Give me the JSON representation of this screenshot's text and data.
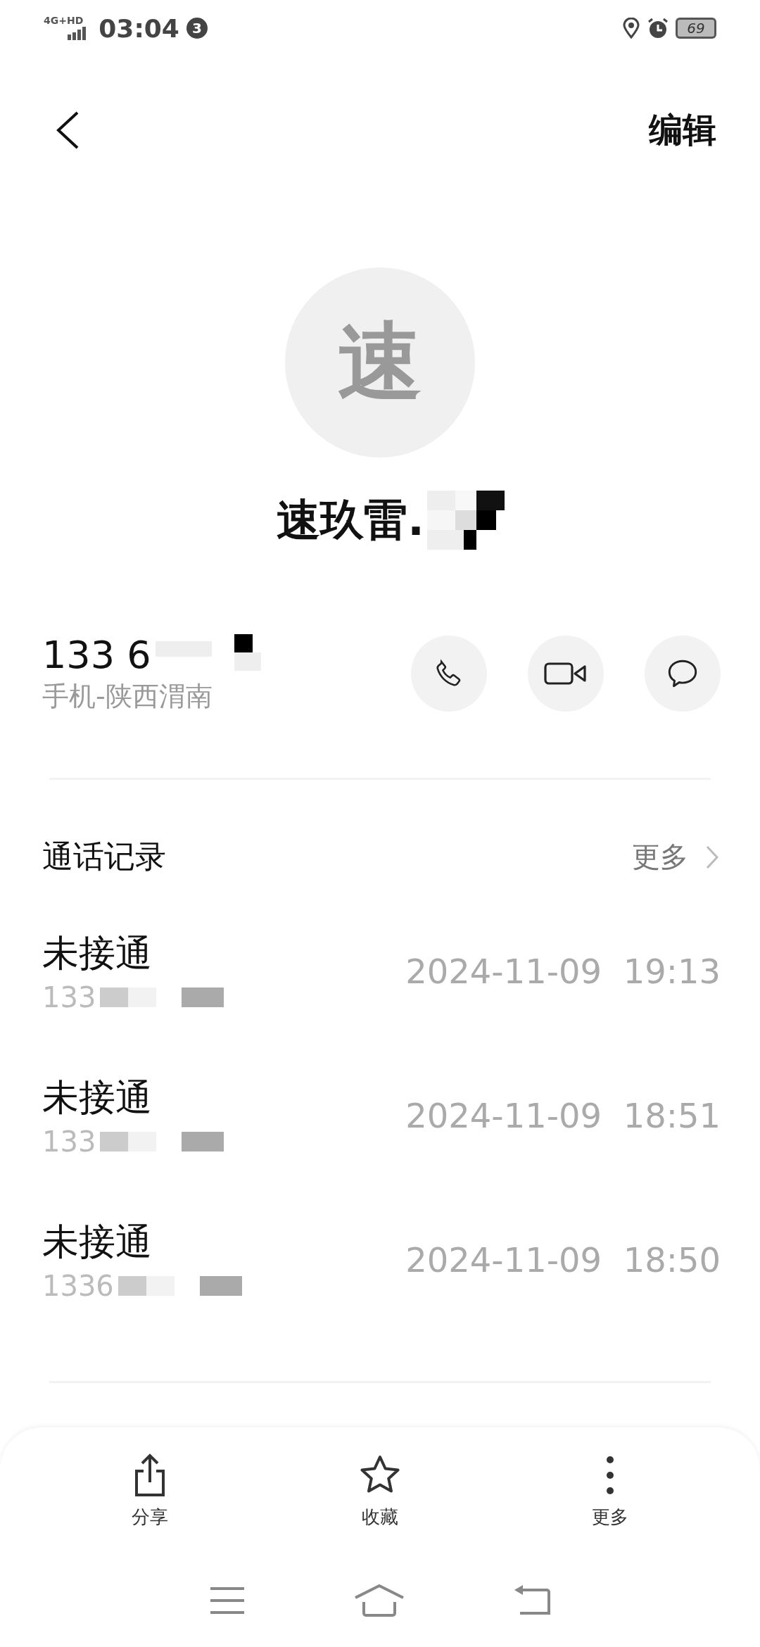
{
  "status_bar": {
    "network": "4G+HD",
    "time": "03:04",
    "notification_count": "3",
    "battery": "69"
  },
  "nav": {
    "action": "编辑"
  },
  "contact": {
    "avatar": "速",
    "name": "速玖雷.",
    "phone": "133 6",
    "phone_label": "手机-陕西渭南"
  },
  "call_log": {
    "title": "通话记录",
    "more": "更多",
    "entries": [
      {
        "status": "未接通",
        "number": "133",
        "time": "2024-11-09  19:13"
      },
      {
        "status": "未接通",
        "number": "133",
        "time": "2024-11-09  18:51"
      },
      {
        "status": "未接通",
        "number": "1336",
        "time": "2024-11-09  18:50"
      }
    ]
  },
  "bottom_actions": [
    {
      "kind": "share",
      "label": "分享"
    },
    {
      "kind": "favorite",
      "label": "收藏"
    },
    {
      "kind": "more",
      "label": "更多"
    }
  ]
}
